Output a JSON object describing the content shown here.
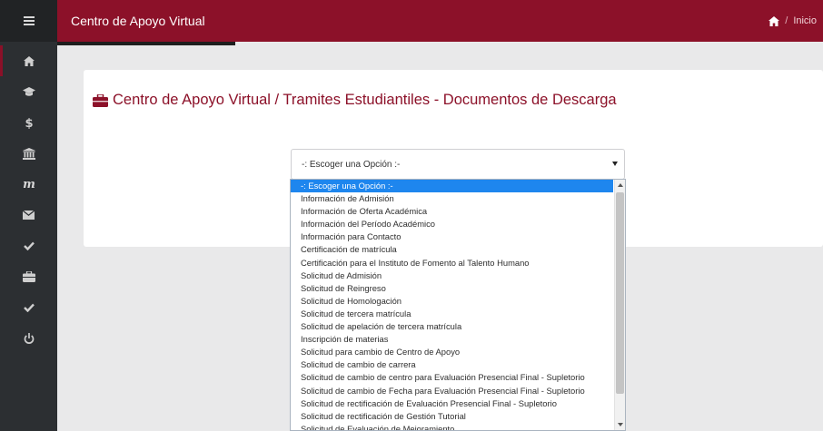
{
  "topbar": {
    "title": "Centro de Apoyo Virtual",
    "breadcrumb": {
      "separator": "/",
      "current": "Inicio"
    }
  },
  "sidebar": {
    "items": [
      {
        "icon": "home-icon"
      },
      {
        "icon": "graduation-cap-icon"
      },
      {
        "icon": "dollar-icon"
      },
      {
        "icon": "institution-icon"
      },
      {
        "icon": "moodle-m-icon",
        "glyph": "m"
      },
      {
        "icon": "envelope-icon"
      },
      {
        "icon": "check-icon"
      },
      {
        "icon": "briefcase-icon"
      },
      {
        "icon": "check-icon"
      },
      {
        "icon": "power-icon"
      }
    ]
  },
  "panel": {
    "title": "Centro de Apoyo Virtual / Tramites Estudiantiles - Documentos de Descarga"
  },
  "select": {
    "selected": "-: Escoger una Opción :-",
    "options": [
      "-: Escoger una Opción :-",
      "Información de Admisión",
      "Información de Oferta Académica",
      "Información del Período Académico",
      "Información para Contacto",
      "Certificación de matrícula",
      "Certificación para el Instituto de Fomento al Talento Humano",
      "Solicitud de Admisión",
      "Solicitud de Reingreso",
      "Solicitud de Homologación",
      "Solicitud de tercera matrícula",
      "Solicitud de apelación de tercera matrícula",
      "Inscripción de materias",
      "Solicitud para cambio de Centro de Apoyo",
      "Solicitud de cambio de carrera",
      "Solicitud de cambio de centro para Evaluación Presencial Final - Supletorio",
      "Solicitud de cambio de Fecha para Evaluación Presencial Final - Supletorio",
      "Solicitud de rectificación de Evaluación Presencial Final - Supletorio",
      "Solicitud de rectificación de Gestión Tutorial",
      "Solicitud de Evaluación de Mejoramiento"
    ]
  },
  "colors": {
    "brand": "#8c1129",
    "sidebar": "#2c2f32",
    "highlight": "#1e86ee"
  }
}
